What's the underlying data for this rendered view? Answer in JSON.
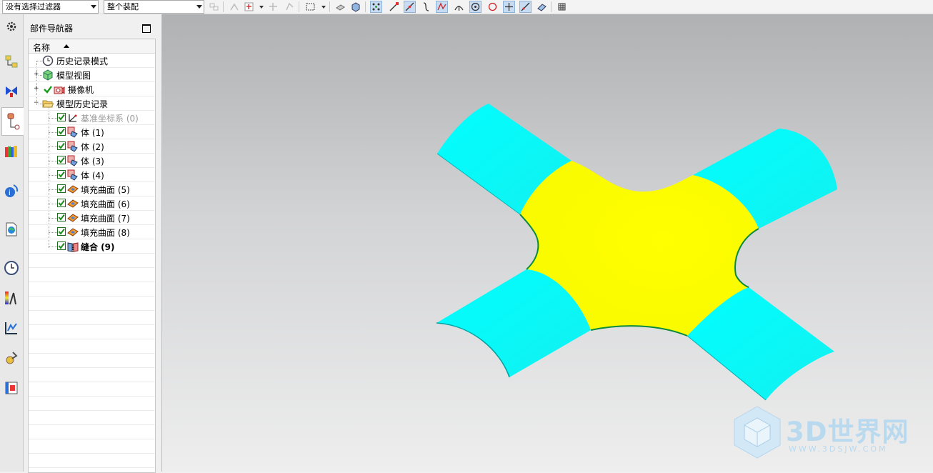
{
  "toolbar": {
    "filter_value": "没有选择过滤器",
    "scope_value": "整个装配"
  },
  "resource_bar": {
    "icons": [
      "settings-icon",
      "assembly-navigator-icon",
      "constraint-navigator-icon",
      "part-navigator-icon",
      "reuse-library-icon",
      "hd3d-tools-icon",
      "web-browser-icon",
      "history-icon",
      "visualization-icon",
      "process-studio-icon",
      "manufacturing-wizard-icon",
      "roles-icon"
    ]
  },
  "navigator": {
    "title": "部件导航器",
    "column_header": "名称",
    "nodes": {
      "history_mode": "历史记录模式",
      "model_views": "模型视图",
      "cameras": "摄像机",
      "model_history": "模型历史记录",
      "features": [
        {
          "label": "基准坐标系 (0)",
          "type": "datum"
        },
        {
          "label": "体 (1)",
          "type": "body"
        },
        {
          "label": "体 (2)",
          "type": "body"
        },
        {
          "label": "体 (3)",
          "type": "body"
        },
        {
          "label": "体 (4)",
          "type": "body"
        },
        {
          "label": "填充曲面 (5)",
          "type": "fill"
        },
        {
          "label": "填充曲面 (6)",
          "type": "fill"
        },
        {
          "label": "填充曲面 (7)",
          "type": "fill"
        },
        {
          "label": "填充曲面 (8)",
          "type": "fill"
        },
        {
          "label": "缝合 (9)",
          "type": "sew"
        }
      ]
    }
  },
  "viewport": {
    "colors": {
      "arms": "#00ffff",
      "center": "#ffff00",
      "edge": "#008a3a"
    },
    "watermark": {
      "title": "3D世界网",
      "url": "WWW.3DSJW.COM"
    }
  }
}
